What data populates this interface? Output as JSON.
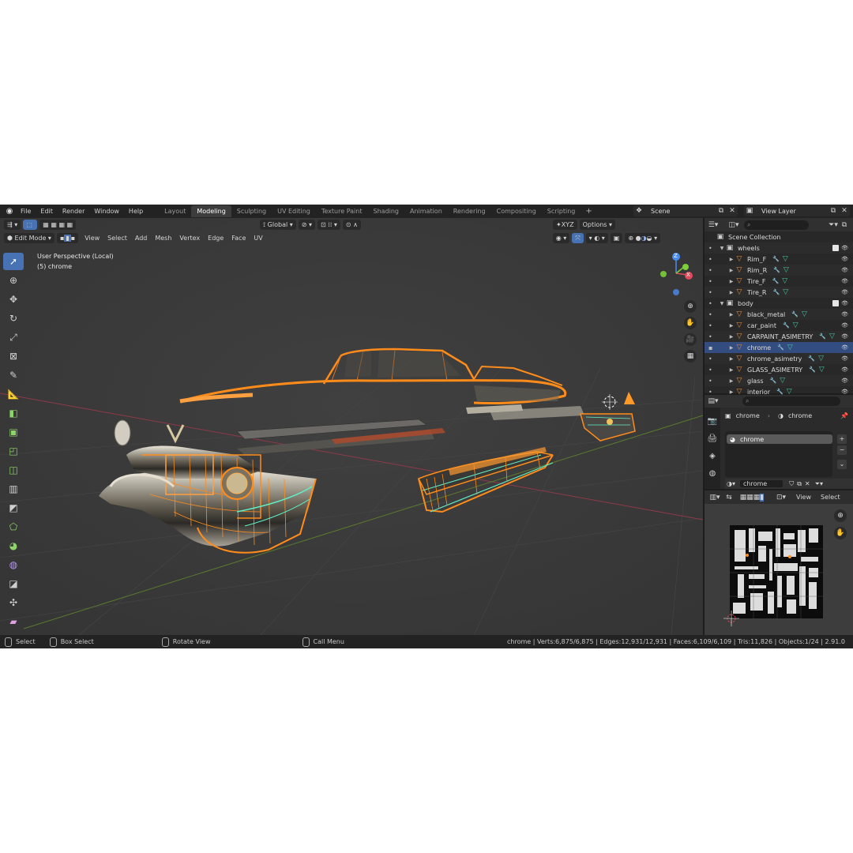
{
  "menu": [
    "File",
    "Edit",
    "Render",
    "Window",
    "Help"
  ],
  "workspaces": [
    {
      "label": "Layout",
      "active": false
    },
    {
      "label": "Modeling",
      "active": true
    },
    {
      "label": "Sculpting",
      "active": false
    },
    {
      "label": "UV Editing",
      "active": false
    },
    {
      "label": "Texture Paint",
      "active": false
    },
    {
      "label": "Shading",
      "active": false
    },
    {
      "label": "Animation",
      "active": false
    },
    {
      "label": "Rendering",
      "active": false
    },
    {
      "label": "Compositing",
      "active": false
    },
    {
      "label": "Scripting",
      "active": false
    }
  ],
  "add_tab": "+",
  "scene": "Scene",
  "view_layer": "View Layer",
  "viewport": {
    "mode": "Edit Mode",
    "menus": [
      "View",
      "Select",
      "Add",
      "Mesh",
      "Vertex",
      "Edge",
      "Face",
      "UV"
    ],
    "orientation": "Global",
    "options": "Options",
    "axes": [
      "X",
      "Y",
      "Z"
    ],
    "perspective": "User Perspective (Local)",
    "object_label": "(5) chrome",
    "gizmo": {
      "z": "Z",
      "y": "Y",
      "x": "X"
    }
  },
  "outliner": {
    "root": "Scene Collection",
    "rows": [
      {
        "type": "collection",
        "label": "wheels",
        "depth": 1,
        "selected": false
      },
      {
        "type": "object",
        "label": "Rim_F",
        "depth": 2,
        "selected": false
      },
      {
        "type": "object",
        "label": "Rim_R",
        "depth": 2,
        "selected": false
      },
      {
        "type": "object",
        "label": "Tire_F",
        "depth": 2,
        "selected": false
      },
      {
        "type": "object",
        "label": "Tire_R",
        "depth": 2,
        "selected": false
      },
      {
        "type": "collection",
        "label": "body",
        "depth": 1,
        "selected": false
      },
      {
        "type": "object",
        "label": "black_metal",
        "depth": 2,
        "selected": false
      },
      {
        "type": "object",
        "label": "car_paint",
        "depth": 2,
        "selected": false
      },
      {
        "type": "object",
        "label": "CARPAINT_ASIMETRY",
        "depth": 2,
        "selected": false
      },
      {
        "type": "object",
        "label": "chrome",
        "depth": 2,
        "selected": true
      },
      {
        "type": "object",
        "label": "chrome_asimetry",
        "depth": 2,
        "selected": false
      },
      {
        "type": "object",
        "label": "GLASS_ASIMETRY",
        "depth": 2,
        "selected": false
      },
      {
        "type": "object",
        "label": "glass",
        "depth": 2,
        "selected": false
      },
      {
        "type": "object",
        "label": "interior",
        "depth": 2,
        "selected": false
      }
    ]
  },
  "properties": {
    "object": "chrome",
    "material": "chrome",
    "slot": "chrome",
    "plus": "+",
    "minus": "−"
  },
  "uv_editor": {
    "material": "chrome",
    "menus": [
      "View",
      "Select"
    ]
  },
  "status": {
    "select": "Select",
    "box_select": "Box Select",
    "rotate": "Rotate View",
    "call_menu": "Call Menu",
    "stats": "chrome | Verts:6,875/6,875 | Edges:12,931/12,931 | Faces:6,109/6,109 | Tris:11,826 | Objects:1/24 | 2.91.0"
  }
}
